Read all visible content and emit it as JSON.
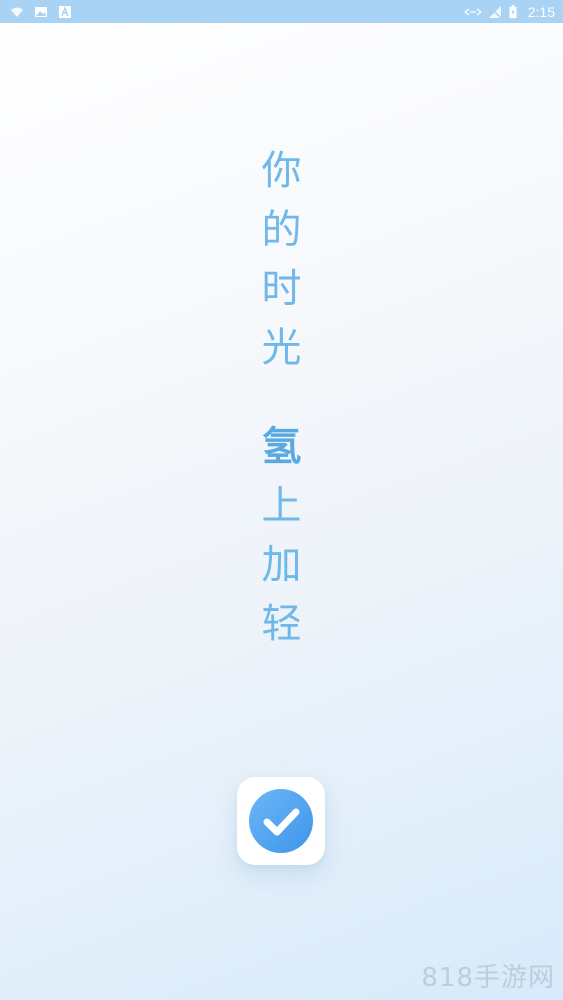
{
  "status_bar": {
    "time": "2:15",
    "left_icons": [
      "wifi-question-icon",
      "image-icon",
      "a-badge-icon"
    ],
    "right_icons": [
      "data-arrows-icon",
      "no-signal-icon",
      "battery-charging-icon"
    ],
    "background": "#a9d3f4"
  },
  "slogan": {
    "top_chars": [
      "你",
      "的",
      "时",
      "光"
    ],
    "bottom_chars": [
      "氢",
      "上",
      "加",
      "轻"
    ],
    "color": "#6fb8ea"
  },
  "logo": {
    "icon": "check-circle-icon",
    "accent": "#4ea1ef"
  },
  "watermark": {
    "text": "818手游网"
  }
}
